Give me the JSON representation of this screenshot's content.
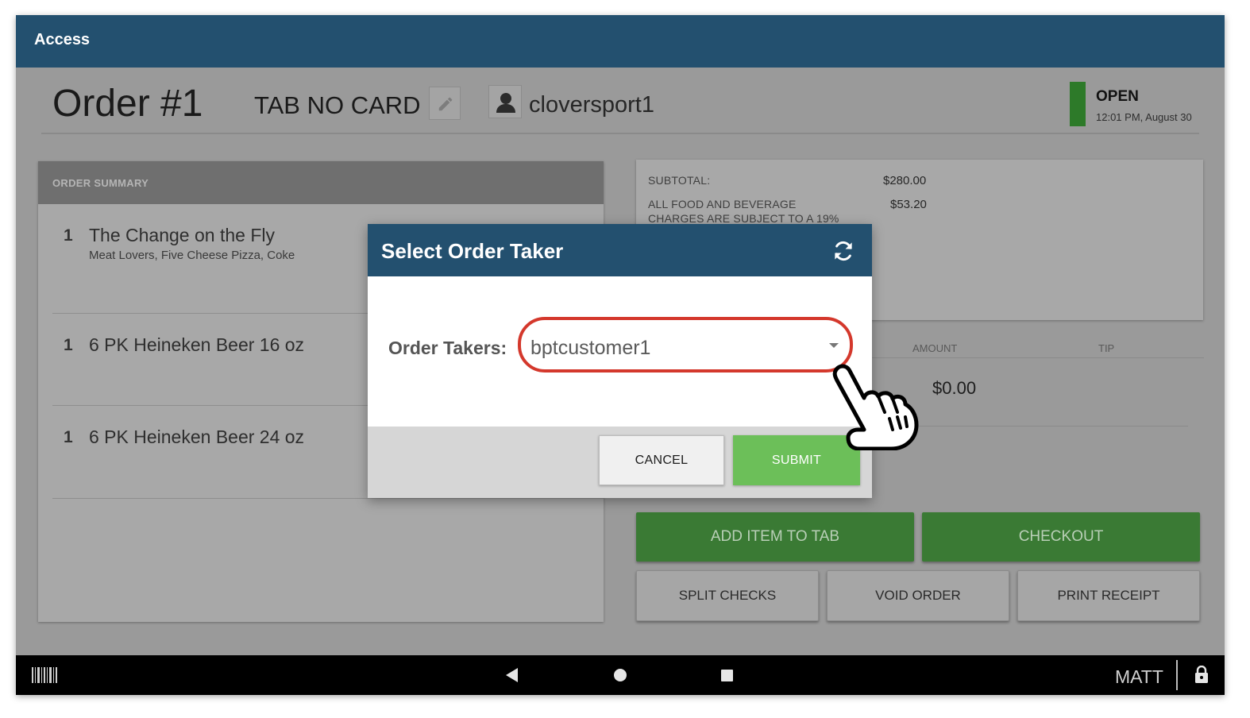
{
  "app": {
    "title": "Access"
  },
  "order": {
    "title": "Order #1",
    "tab_name": "TAB NO CARD",
    "user_name": "cloversport1",
    "status": "OPEN",
    "status_time": "12:01 PM, August 30",
    "status_color": "#2d7a29"
  },
  "summary": {
    "heading": "ORDER SUMMARY",
    "items": [
      {
        "qty": "1",
        "name": "The Change on the Fly",
        "modifiers": "Meat Lovers, Five Cheese Pizza, Coke"
      },
      {
        "qty": "1",
        "name": "6 PK Heineken Beer 16 oz",
        "modifiers": ""
      },
      {
        "qty": "1",
        "name": "6 PK Heineken Beer 24 oz",
        "modifiers": ""
      }
    ]
  },
  "totals": {
    "subtotal_label": "SUBTOTAL:",
    "subtotal_value": "$280.00",
    "charge_label_1": "ALL FOOD AND BEVERAGE",
    "charge_label_2": "CHARGES ARE SUBJECT TO A 19%",
    "charge_value": "$53.20"
  },
  "payments": {
    "amount_header": "AMOUNT",
    "tip_header": "TIP",
    "amount_value": "$0.00"
  },
  "actions": {
    "add_item": "ADD ITEM TO TAB",
    "checkout": "CHECKOUT",
    "split_checks": "SPLIT CHECKS",
    "void_order": "VOID ORDER",
    "print_receipt": "PRINT RECEIPT"
  },
  "dialog": {
    "title": "Select Order Taker",
    "field_label": "Order Takers:",
    "selected_value": "bptcustomer1",
    "cancel_label": "CANCEL",
    "submit_label": "SUBMIT",
    "highlight_color": "#d4382c"
  },
  "navbar": {
    "user": "MATT",
    "icons": [
      "barcode-icon",
      "back-icon",
      "home-icon",
      "recents-icon",
      "lock-icon"
    ]
  }
}
